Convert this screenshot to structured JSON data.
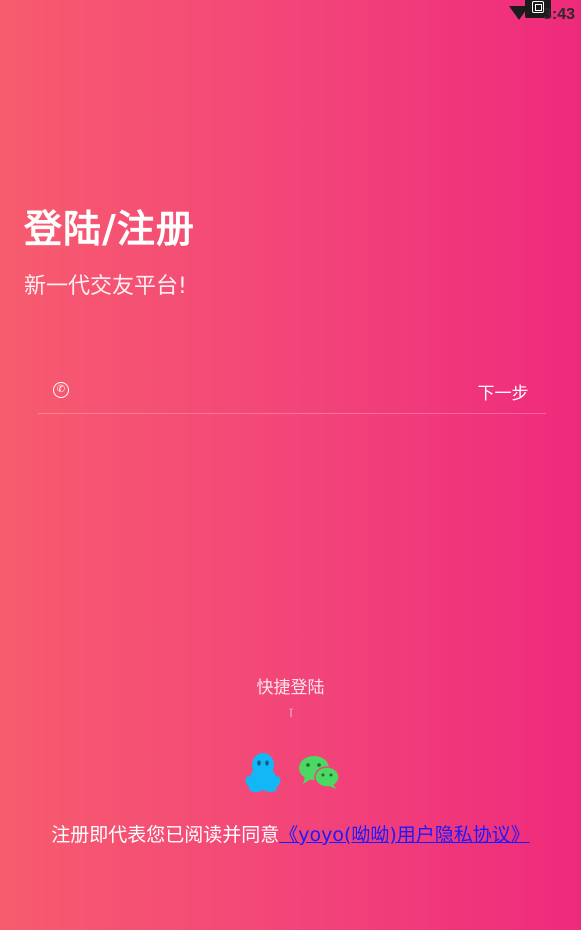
{
  "status_bar": {
    "time": "3:43",
    "icons": [
      "wifi-icon",
      "screenshot-icon"
    ]
  },
  "login": {
    "title": "登陆/注册",
    "subtitle": "新一代交友平台!",
    "phone_placeholder": "",
    "phone_icon": "phone-icon",
    "phone_icon_glyph": "✆",
    "next_label": "下一步"
  },
  "quick_login": {
    "label": "快捷登陆",
    "mark": "ǐ",
    "providers": [
      {
        "name": "QQ",
        "icon": "qq-icon",
        "color": "#12b7f5"
      },
      {
        "name": "WeChat",
        "icon": "wechat-icon",
        "color": "#4bd863"
      }
    ]
  },
  "agreement": {
    "prefix": "注册即代表您已阅读并同意",
    "link": "《yoyo(呦呦)用户隐私协议》"
  },
  "colors": {
    "gradient_start": "#f75c6e",
    "gradient_end": "#ef2a7c",
    "link": "#1a1aff"
  }
}
